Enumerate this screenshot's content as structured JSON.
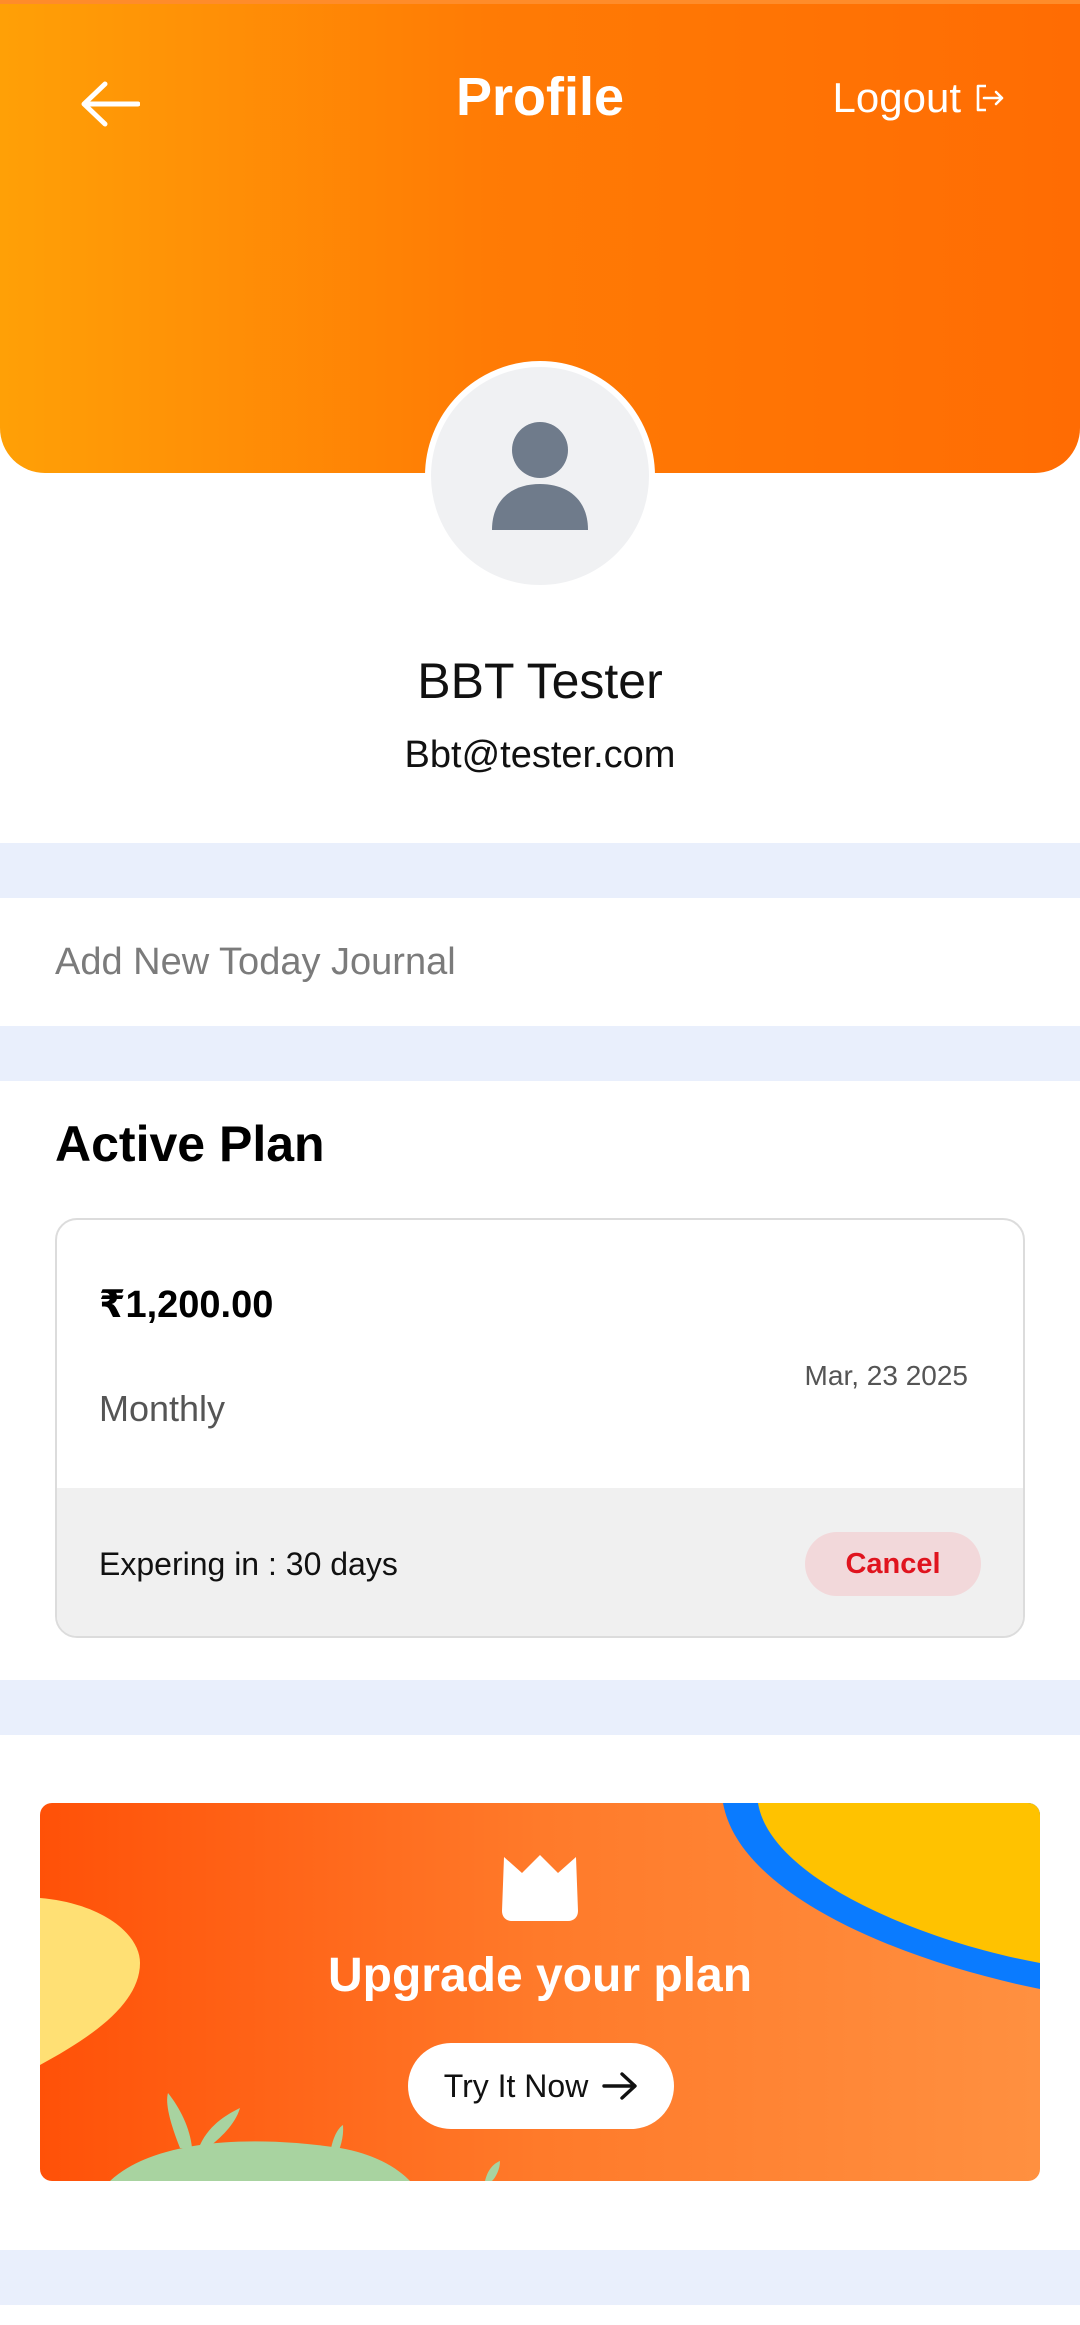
{
  "header": {
    "title": "Profile",
    "back_icon": "arrow-left-icon",
    "logout_label": "Logout",
    "logout_icon": "logout-icon",
    "gradient_start": "#ffa006",
    "gradient_end": "#ff6c03"
  },
  "profile": {
    "avatar_icon": "user-silhouette-icon",
    "name": "BBT Tester",
    "email": "Bbt@tester.com"
  },
  "journal": {
    "label": "Add New Today Journal"
  },
  "active_plan": {
    "title": "Active Plan",
    "price": "₹1,200.00",
    "cycle": "Monthly",
    "date": "Mar, 23 2025",
    "expiry": "Expering in : 30 days",
    "cancel_label": "Cancel",
    "cancel_color": "#e0141e"
  },
  "upgrade": {
    "crown_icon": "crown-icon",
    "title": "Upgrade your plan",
    "button_label": "Try It Now",
    "button_icon": "arrow-right-icon"
  },
  "colors": {
    "divider": "#e9effc",
    "accent": "#ff7b05"
  }
}
